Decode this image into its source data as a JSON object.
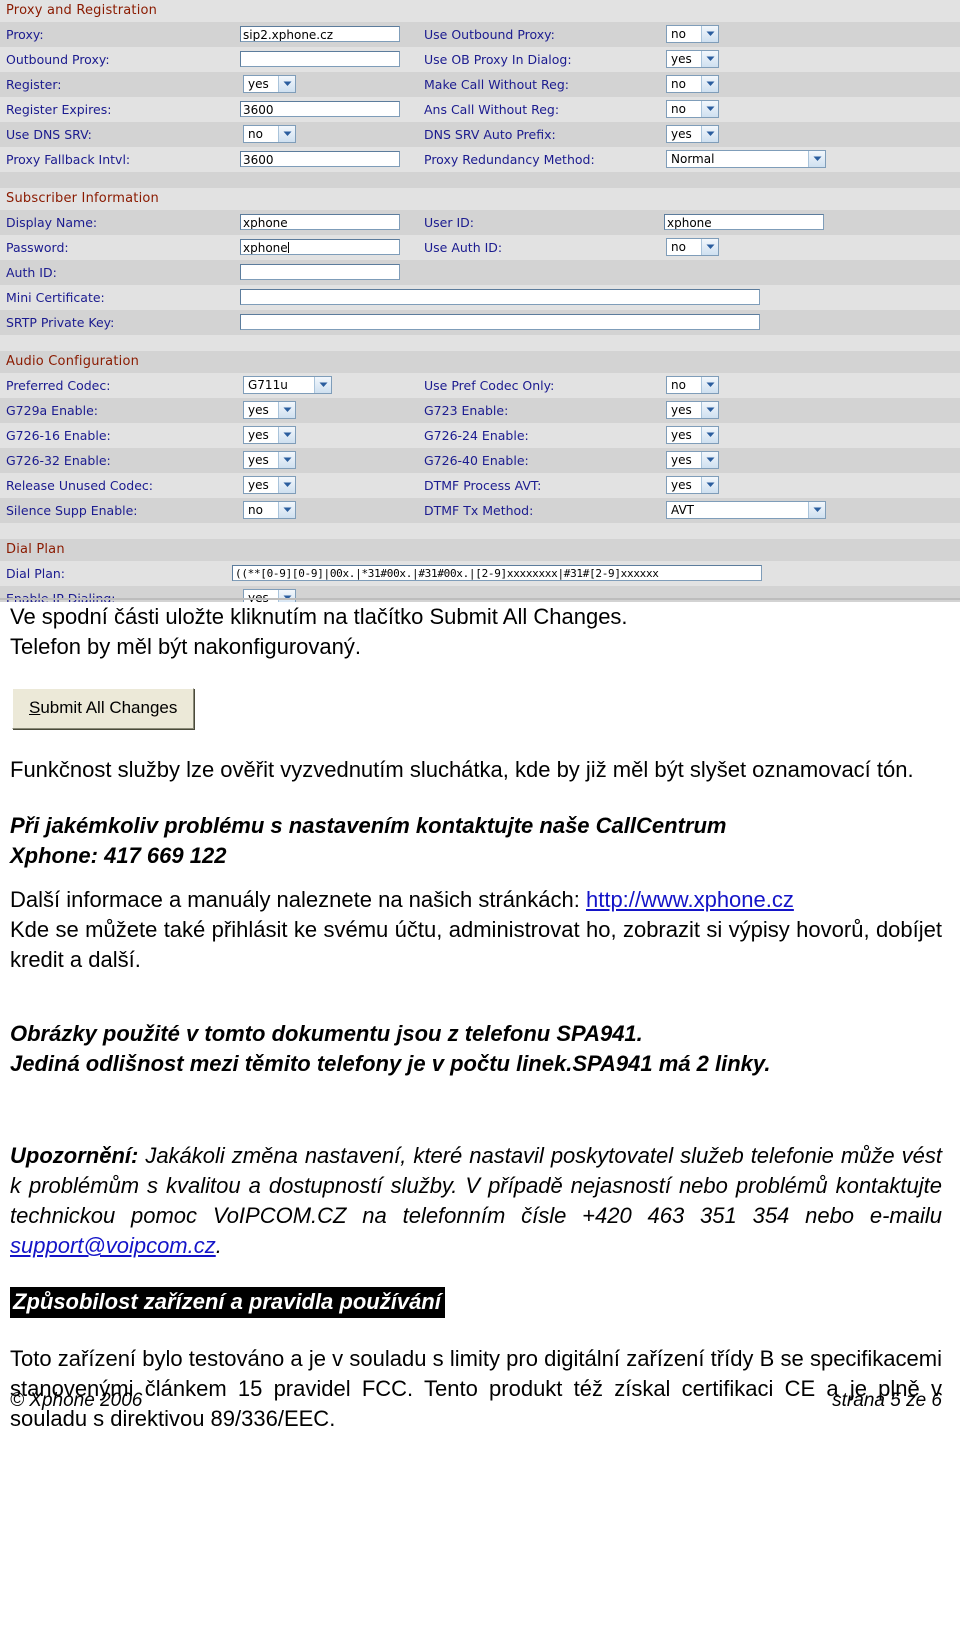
{
  "config_screenshot": {
    "sections": [
      {
        "title": "Proxy and Registration",
        "rows": [
          {
            "left_label": "Proxy:",
            "left_type": "text",
            "left_value": "sip2.xphone.cz",
            "right_label": "Use Outbound Proxy:",
            "right_type": "select",
            "right_value": "no"
          },
          {
            "left_label": "Outbound Proxy:",
            "left_type": "text",
            "left_value": "",
            "right_label": "Use OB Proxy In Dialog:",
            "right_type": "select",
            "right_value": "yes"
          },
          {
            "left_label": "Register:",
            "left_type": "select",
            "left_value": "yes",
            "right_label": "Make Call Without Reg:",
            "right_type": "select",
            "right_value": "no"
          },
          {
            "left_label": "Register Expires:",
            "left_type": "text",
            "left_value": "3600",
            "right_label": "Ans Call Without Reg:",
            "right_type": "select",
            "right_value": "no"
          },
          {
            "left_label": "Use DNS SRV:",
            "left_type": "select",
            "left_value": "no",
            "right_label": "DNS SRV Auto Prefix:",
            "right_type": "select",
            "right_value": "yes"
          },
          {
            "left_label": "Proxy Fallback Intvl:",
            "left_type": "text",
            "left_value": "3600",
            "right_label": "Proxy Redundancy Method:",
            "right_type": "select-wide",
            "right_value": "Normal"
          }
        ]
      },
      {
        "title": "Subscriber Information",
        "rows": [
          {
            "left_label": "Display Name:",
            "left_type": "text",
            "left_value": "xphone",
            "right_label": "User ID:",
            "right_type": "text",
            "right_value": "xphone"
          },
          {
            "left_label": "Password:",
            "left_type": "text-caret",
            "left_value": "xphone",
            "right_label": "Use Auth ID:",
            "right_type": "select",
            "right_value": "no"
          },
          {
            "left_label": "Auth ID:",
            "left_type": "text",
            "left_value": "",
            "right_label": "",
            "right_type": "none",
            "right_value": ""
          },
          {
            "left_label": "Mini Certificate:",
            "left_type": "wide",
            "left_value": "",
            "right_label": "",
            "right_type": "none",
            "right_value": ""
          },
          {
            "left_label": "SRTP Private Key:",
            "left_type": "wide",
            "left_value": "",
            "right_label": "",
            "right_type": "none",
            "right_value": ""
          }
        ]
      },
      {
        "title": "Audio Configuration",
        "rows": [
          {
            "left_label": "Preferred Codec:",
            "left_type": "select-mid",
            "left_value": "G711u",
            "right_label": "Use Pref Codec Only:",
            "right_type": "select",
            "right_value": "no"
          },
          {
            "left_label": "G729a Enable:",
            "left_type": "select",
            "left_value": "yes",
            "right_label": "G723 Enable:",
            "right_type": "select",
            "right_value": "yes"
          },
          {
            "left_label": "G726-16 Enable:",
            "left_type": "select",
            "left_value": "yes",
            "right_label": "G726-24 Enable:",
            "right_type": "select",
            "right_value": "yes"
          },
          {
            "left_label": "G726-32 Enable:",
            "left_type": "select",
            "left_value": "yes",
            "right_label": "G726-40 Enable:",
            "right_type": "select",
            "right_value": "yes"
          },
          {
            "left_label": "Release Unused Codec:",
            "left_type": "select",
            "left_value": "yes",
            "right_label": "DTMF Process AVT:",
            "right_type": "select",
            "right_value": "yes"
          },
          {
            "left_label": "Silence Supp Enable:",
            "left_type": "select",
            "left_value": "no",
            "right_label": "DTMF Tx Method:",
            "right_type": "select-wide",
            "right_value": "AVT"
          }
        ]
      },
      {
        "title": "Dial Plan",
        "rows": [
          {
            "left_label": "Dial Plan:",
            "left_type": "dialplan",
            "left_value": "((**[0-9][0-9]|00x.|*31#00x.|#31#00x.|[2-9]xxxxxxxx|#31#[2-9]xxxxxx",
            "right_label": "",
            "right_type": "none",
            "right_value": ""
          },
          {
            "left_label": "Enable IP Dialing:",
            "left_type": "select",
            "left_value": "yes",
            "right_label": "",
            "right_type": "none",
            "right_value": ""
          }
        ]
      }
    ],
    "colors": {
      "section_title": "#8a1a00",
      "label": "#1b1b8f",
      "band_light": "#e2e2e2",
      "band_dark": "#d3d3d3"
    }
  },
  "document": {
    "intro_line1": "Ve spodní části uložte kliknutím na tlačítko Submit All Changes.",
    "intro_line2": "Telefon by měl být nakonfigurovaný.",
    "submit_button": {
      "accel_letter": "S",
      "rest_label": "ubmit All Changes"
    },
    "verify_paragraph": "Funkčnost služby lze ověřit vyzvednutím sluchátka, kde by již měl být slyšet oznamovací tón.",
    "callcentrum_line1": "Při jakémkoliv problému s nastavením kontaktujte naše CallCentrum",
    "callcentrum_line2": "Xphone: 417 669 122",
    "more_info_prefix": "Další informace a manuály naleznete na našich stránkách: ",
    "more_info_link": "http://www.xphone.cz",
    "more_info_body": "Kde se můžete také přihlásit ke svému účtu, administrovat ho, zobrazit si výpisy hovorů, dobíjet kredit a další.",
    "images_note_line1": "Obrázky použité v tomto dokumentu jsou z telefonu SPA941.",
    "images_note_line2": "Jediná odlišnost mezi těmito telefony je v počtu linek.SPA941 má 2 linky.",
    "warning_label": "Upozornění:",
    "warning_body_a": " Jakákoli změna nastavení, které nastavil poskytovatel služeb telefonie může vést k problémům s kvalitou a dostupností služby. V případě nejasností nebo problémů kontaktujte technickou pomoc  VoIPCOM.CZ na telefonním čísle +420 463 351 354 nebo e-mailu ",
    "warning_email": "support@voipcom.cz",
    "warning_body_b": ".",
    "compliance_heading": "Způsobilost zařízení a pravidla používání",
    "compliance_body": "Toto zařízení bylo testováno a je v souladu s limity pro digitální zařízení třídy B se specifikacemi stanovenými článkem 15 pravidel FCC. Tento produkt též získal certifikaci CE a je plně v souladu s direktivou 89/336/EEC.",
    "footer_left": "© Xphone 2006",
    "footer_right": "strana 5 ze 6",
    "link_color": "#1414c8"
  }
}
